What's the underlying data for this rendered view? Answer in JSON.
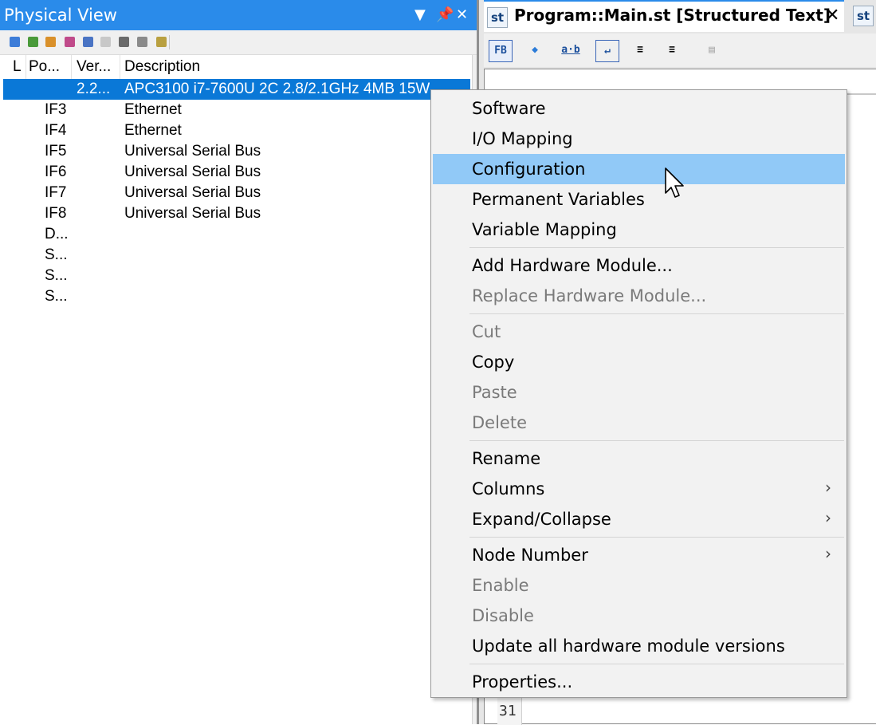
{
  "physical_view": {
    "title": "Physical View",
    "columns": [
      "L",
      "Po...",
      "Ver...",
      "Description"
    ],
    "rows": [
      {
        "position": "",
        "version": "2.2...",
        "description": "APC3100 i7-7600U 2C 2.8/2.1GHz 4MB 15W",
        "selected": true
      },
      {
        "position": "IF3",
        "version": "",
        "description": "Ethernet"
      },
      {
        "position": "IF4",
        "version": "",
        "description": "Ethernet"
      },
      {
        "position": "IF5",
        "version": "",
        "description": "Universal Serial Bus"
      },
      {
        "position": "IF6",
        "version": "",
        "description": "Universal Serial Bus"
      },
      {
        "position": "IF7",
        "version": "",
        "description": "Universal Serial Bus"
      },
      {
        "position": "IF8",
        "version": "",
        "description": "Universal Serial Bus"
      },
      {
        "position": "D...",
        "version": "",
        "description": ""
      },
      {
        "position": "S...",
        "version": "",
        "description": ""
      },
      {
        "position": "S...",
        "version": "",
        "description": ""
      },
      {
        "position": "S...",
        "version": "",
        "description": ""
      }
    ]
  },
  "editor": {
    "tab_icon": "st",
    "tab_title": "Program::Main.st [Structured Text]",
    "tab_close": "✕",
    "toolbar_buttons": [
      "FB",
      "◆",
      "a·b",
      "↵",
      "≡",
      "≡",
      "▤"
    ],
    "line_number": "31"
  },
  "context_menu": {
    "groups": [
      [
        {
          "label": "Software",
          "enabled": true
        },
        {
          "label": "I/O Mapping",
          "enabled": true
        },
        {
          "label": "Configuration",
          "enabled": true,
          "highlighted": true
        },
        {
          "label": "Permanent Variables",
          "enabled": true
        },
        {
          "label": "Variable Mapping",
          "enabled": true
        }
      ],
      [
        {
          "label": "Add Hardware Module...",
          "enabled": true
        },
        {
          "label": "Replace Hardware Module...",
          "enabled": false
        }
      ],
      [
        {
          "label": "Cut",
          "enabled": false
        },
        {
          "label": "Copy",
          "enabled": true
        },
        {
          "label": "Paste",
          "enabled": false
        },
        {
          "label": "Delete",
          "enabled": false
        }
      ],
      [
        {
          "label": "Rename",
          "enabled": true
        },
        {
          "label": "Columns",
          "enabled": true,
          "submenu": true
        },
        {
          "label": "Expand/Collapse",
          "enabled": true,
          "submenu": true
        }
      ],
      [
        {
          "label": "Node Number",
          "enabled": true,
          "submenu": true
        },
        {
          "label": "Enable",
          "enabled": false
        },
        {
          "label": "Disable",
          "enabled": false
        },
        {
          "label": "Update all hardware module versions",
          "enabled": true
        }
      ],
      [
        {
          "label": "Properties...",
          "enabled": true
        }
      ]
    ]
  },
  "colors": {
    "title_bar": "#2a8bea",
    "selection": "#0a78d7",
    "menu_hover": "#91c9f7",
    "disabled_text": "#7a7a7a"
  }
}
